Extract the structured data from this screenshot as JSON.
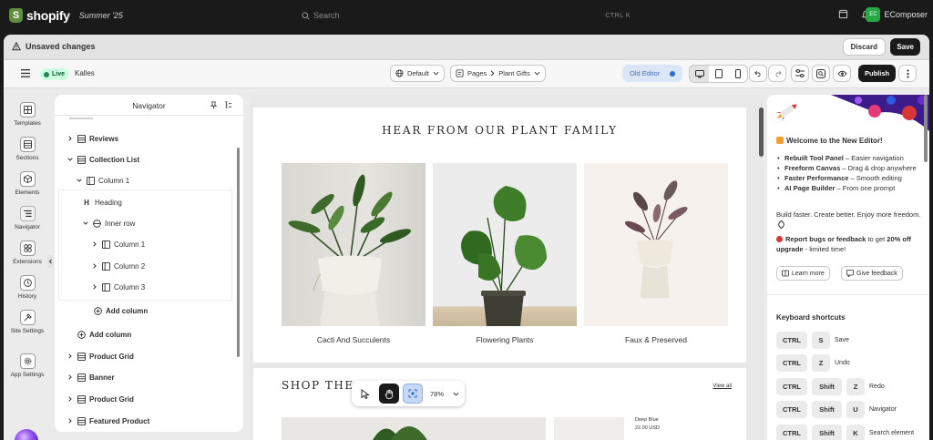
{
  "topbar": {
    "brand_letter": "S",
    "brand": "shopify",
    "edition": "Summer '25",
    "search_placeholder": "Search",
    "search_shortcut": "CTRL   K",
    "store_avatar": "EC",
    "store_name": "EComposer"
  },
  "unsaved": {
    "title": "Unsaved changes",
    "discard": "Discard",
    "save": "Save"
  },
  "toolbar": {
    "live": "Live",
    "theme": "Kalles",
    "default_dd": "Default",
    "pages_dd": "Pages",
    "page_name": "Plant Gifts",
    "old_editor": "Old Editor",
    "publish": "Publish"
  },
  "rail": [
    {
      "label": "Templates",
      "icon": "templates-icon"
    },
    {
      "label": "Sections",
      "icon": "sections-icon"
    },
    {
      "label": "Elements",
      "icon": "elements-icon"
    },
    {
      "label": "Navigator",
      "icon": "navigator-icon"
    },
    {
      "label": "Extensions",
      "icon": "extensions-icon"
    },
    {
      "label": "History",
      "icon": "history-icon"
    },
    {
      "label": "Site Settings",
      "icon": "site-settings-icon"
    },
    {
      "label": "App Settings",
      "icon": "app-settings-icon"
    }
  ],
  "navigator": {
    "title": "Navigator",
    "items": [
      {
        "label": "Reviews",
        "kind": "section"
      },
      {
        "label": "Collection List",
        "kind": "section"
      },
      {
        "label": "Column 1",
        "kind": "column"
      },
      {
        "label": "Heading",
        "kind": "heading",
        "letter": "H"
      },
      {
        "label": "Inner row",
        "kind": "row"
      },
      {
        "label": "Column 1",
        "kind": "column"
      },
      {
        "label": "Column 2",
        "kind": "column"
      },
      {
        "label": "Column 3",
        "kind": "column"
      },
      {
        "label": "Add column",
        "kind": "add"
      },
      {
        "label": "Add column",
        "kind": "add"
      },
      {
        "label": "Product Grid",
        "kind": "section"
      },
      {
        "label": "Banner",
        "kind": "section"
      },
      {
        "label": "Product Grid",
        "kind": "section"
      },
      {
        "label": "Featured Product",
        "kind": "section"
      }
    ]
  },
  "canvas": {
    "section_title": "HEAR FROM OUR PLANT FAMILY",
    "cards": [
      {
        "caption": "Cacti And Succulents"
      },
      {
        "caption": "Flowering Plants"
      },
      {
        "caption": "Faux & Preserved"
      }
    ],
    "shop_title": "SHOP THE SPACE",
    "view_all": "View all",
    "product_name": "Deep Blue",
    "product_price": "22.00 USD",
    "zoom": "78%"
  },
  "right_panel": {
    "welcome": "Welcome to the New Editor!",
    "features": [
      {
        "bold": "Rebuilt Tool Panel",
        "rest": " – Easier navigation"
      },
      {
        "bold": "Freeform Canvas",
        "rest": " – Drag & drop anywhere"
      },
      {
        "bold": "Faster Performance",
        "rest": " – Smooth editing"
      },
      {
        "bold": "AI Page Builder",
        "rest": " – From one prompt"
      }
    ],
    "tagline": "Build faster. Create better. Enjoy more freedom.",
    "report_bold": "Report bugs or feedback",
    "report_mid": " to get ",
    "report_bold2": "20% off upgrade",
    "report_end": " - limited time!",
    "learn_more": "Learn more",
    "give_feedback": "Give feedback",
    "shortcuts_title": "Keyboard shortcuts",
    "shortcuts": [
      {
        "keys": [
          "CTRL",
          "S"
        ],
        "action": "Save"
      },
      {
        "keys": [
          "CTRL",
          "Z"
        ],
        "action": "Undo"
      },
      {
        "keys": [
          "CTRL",
          "Shift",
          "Z"
        ],
        "action": "Redo"
      },
      {
        "keys": [
          "CTRL",
          "Shift",
          "U"
        ],
        "action": "Navigator"
      },
      {
        "keys": [
          "CTRL",
          "Shift",
          "K"
        ],
        "action": "Search element"
      }
    ]
  }
}
